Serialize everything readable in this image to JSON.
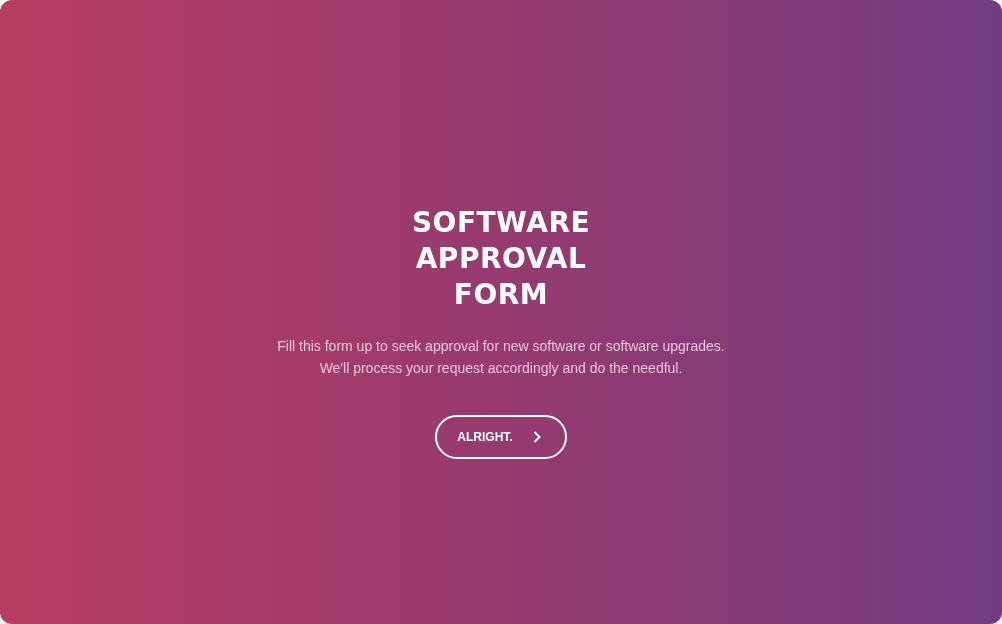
{
  "title": "SOFTWARE APPROVAL FORM",
  "description": "Fill this form up to seek approval for new software or software upgrades. We'll process your request accordingly and do the needful.",
  "button": {
    "label": "ALRIGHT."
  }
}
